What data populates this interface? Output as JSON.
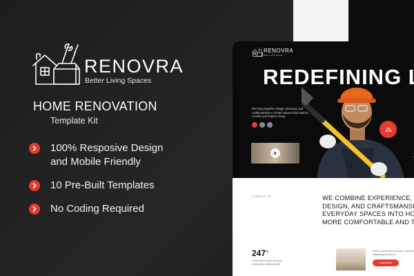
{
  "brand": {
    "name": "RENOVRA",
    "tagline": "Better Living Spaces"
  },
  "kit": {
    "title": "HOME RENOVATION",
    "subtitle": "Template Kit"
  },
  "features": [
    {
      "line1": "100% Resposive Design",
      "line2": "and Mobile Friendly"
    },
    {
      "line1": "10 Pre-Built Templates",
      "line2": ""
    },
    {
      "line1": "No Coding Required",
      "line2": ""
    }
  ],
  "mockup": {
    "brand": "RENOVRA",
    "tagline": "Better Living Spaces",
    "headline": "REDEFINING LI",
    "hero_text": "We bring together design, planning, and craftsmanship to create spaces that balance comfort and modern living",
    "side_text": "Lo",
    "about_label": "O ABOUT US",
    "about_lines": [
      "WE COMBINE EXPERIENCE, THOUG",
      "DESIGN, AND CRAFTSMANSHIP TO",
      "EVERYDAY SPACES INTO HOMES T",
      "MORE COMFORTABLE AND TRULY"
    ],
    "stat_value": "247",
    "stat_plus": "+",
    "stat_text": "Lorem ipsum dolor sit amet consectetur adipiscing elit",
    "room_text": "Lorem ipsum dolor sit amet, consectetur adipiscing elit sed do",
    "cta_label": "Learn More"
  },
  "colors": {
    "accent": "#e63b2e",
    "background": "#232323",
    "hero_bg": "#0b0b0b"
  },
  "icons": {
    "bullet": "chevron-right-circle-icon",
    "logo": "house-tools-icon",
    "play": "play-icon",
    "social": [
      "facebook-icon",
      "twitter-icon",
      "instagram-icon"
    ]
  }
}
